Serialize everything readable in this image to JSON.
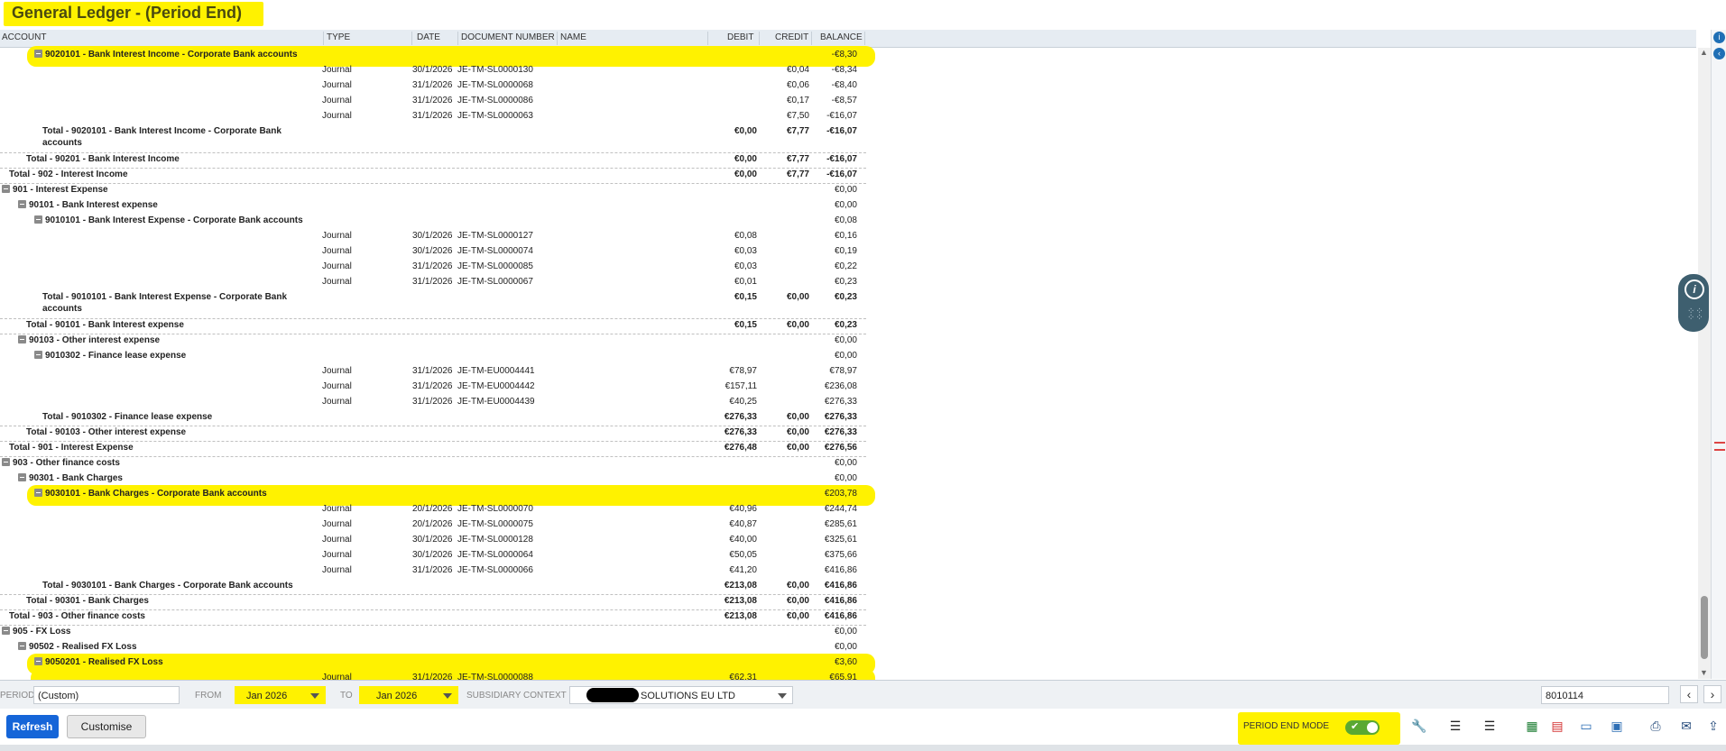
{
  "title": "General Ledger - (Period End)",
  "columns": {
    "account": "ACCOUNT",
    "type": "TYPE",
    "date": "DATE",
    "doc": "DOCUMENT NUMBER",
    "name": "NAME",
    "debit": "DEBIT",
    "credit": "CREDIT",
    "balance": "BALANCE"
  },
  "rows": [
    {
      "kind": "group",
      "indent": 2,
      "label": "9020101 - Bank Interest Income - Corporate Bank accounts",
      "balance": "-€8,30",
      "highlight": true
    },
    {
      "kind": "line",
      "type": "Journal",
      "date": "30/1/2026",
      "doc": "JE-TM-SL0000130",
      "debit": "",
      "credit": "€0,04",
      "balance": "-€8,34"
    },
    {
      "kind": "line",
      "type": "Journal",
      "date": "31/1/2026",
      "doc": "JE-TM-SL0000068",
      "debit": "",
      "credit": "€0,06",
      "balance": "-€8,40"
    },
    {
      "kind": "line",
      "type": "Journal",
      "date": "31/1/2026",
      "doc": "JE-TM-SL0000086",
      "debit": "",
      "credit": "€0,17",
      "balance": "-€8,57"
    },
    {
      "kind": "line",
      "type": "Journal",
      "date": "31/1/2026",
      "doc": "JE-TM-SL0000063",
      "debit": "",
      "credit": "€7,50",
      "balance": "-€16,07"
    },
    {
      "kind": "total",
      "indent": 2,
      "label": "Total - 9020101 - Bank Interest Income - Corporate Bank",
      "label2": "accounts",
      "debit": "€0,00",
      "credit": "€7,77",
      "balance": "-€16,07"
    },
    {
      "kind": "total",
      "indent": 1,
      "label": "Total - 90201 - Bank Interest Income",
      "debit": "€0,00",
      "credit": "€7,77",
      "balance": "-€16,07"
    },
    {
      "kind": "total",
      "indent": 0,
      "label": "Total - 902 - Interest Income",
      "debit": "€0,00",
      "credit": "€7,77",
      "balance": "-€16,07"
    },
    {
      "kind": "group",
      "indent": 0,
      "label": "901 - Interest Expense",
      "balance": "€0,00"
    },
    {
      "kind": "group",
      "indent": 1,
      "label": "90101 - Bank Interest expense",
      "balance": "€0,00"
    },
    {
      "kind": "group",
      "indent": 2,
      "label": "9010101 - Bank Interest Expense - Corporate Bank accounts",
      "balance": "€0,08"
    },
    {
      "kind": "line",
      "type": "Journal",
      "date": "30/1/2026",
      "doc": "JE-TM-SL0000127",
      "debit": "€0,08",
      "credit": "",
      "balance": "€0,16"
    },
    {
      "kind": "line",
      "type": "Journal",
      "date": "30/1/2026",
      "doc": "JE-TM-SL0000074",
      "debit": "€0,03",
      "credit": "",
      "balance": "€0,19"
    },
    {
      "kind": "line",
      "type": "Journal",
      "date": "31/1/2026",
      "doc": "JE-TM-SL0000085",
      "debit": "€0,03",
      "credit": "",
      "balance": "€0,22"
    },
    {
      "kind": "line",
      "type": "Journal",
      "date": "31/1/2026",
      "doc": "JE-TM-SL0000067",
      "debit": "€0,01",
      "credit": "",
      "balance": "€0,23"
    },
    {
      "kind": "total",
      "indent": 2,
      "label": "Total - 9010101 - Bank Interest Expense - Corporate Bank",
      "label2": "accounts",
      "debit": "€0,15",
      "credit": "€0,00",
      "balance": "€0,23"
    },
    {
      "kind": "total",
      "indent": 1,
      "label": "Total - 90101 - Bank Interest expense",
      "debit": "€0,15",
      "credit": "€0,00",
      "balance": "€0,23"
    },
    {
      "kind": "group",
      "indent": 1,
      "label": "90103 - Other interest expense",
      "balance": "€0,00"
    },
    {
      "kind": "group",
      "indent": 2,
      "label": "9010302 - Finance lease expense",
      "balance": "€0,00"
    },
    {
      "kind": "line",
      "type": "Journal",
      "date": "31/1/2026",
      "doc": "JE-TM-EU0004441",
      "debit": "€78,97",
      "credit": "",
      "balance": "€78,97"
    },
    {
      "kind": "line",
      "type": "Journal",
      "date": "31/1/2026",
      "doc": "JE-TM-EU0004442",
      "debit": "€157,11",
      "credit": "",
      "balance": "€236,08"
    },
    {
      "kind": "line",
      "type": "Journal",
      "date": "31/1/2026",
      "doc": "JE-TM-EU0004439",
      "debit": "€40,25",
      "credit": "",
      "balance": "€276,33"
    },
    {
      "kind": "total",
      "indent": 2,
      "label": "Total - 9010302 - Finance lease expense",
      "debit": "€276,33",
      "credit": "€0,00",
      "balance": "€276,33"
    },
    {
      "kind": "total",
      "indent": 1,
      "label": "Total - 90103 - Other interest expense",
      "debit": "€276,33",
      "credit": "€0,00",
      "balance": "€276,33"
    },
    {
      "kind": "total",
      "indent": 0,
      "label": "Total - 901 - Interest Expense",
      "debit": "€276,48",
      "credit": "€0,00",
      "balance": "€276,56"
    },
    {
      "kind": "group",
      "indent": 0,
      "label": "903 - Other finance costs",
      "balance": "€0,00"
    },
    {
      "kind": "group",
      "indent": 1,
      "label": "90301 - Bank Charges",
      "balance": "€0,00"
    },
    {
      "kind": "group",
      "indent": 2,
      "label": "9030101 - Bank Charges - Corporate Bank accounts",
      "balance": "€203,78",
      "highlight": true
    },
    {
      "kind": "line",
      "type": "Journal",
      "date": "20/1/2026",
      "doc": "JE-TM-SL0000070",
      "debit": "€40,96",
      "credit": "",
      "balance": "€244,74"
    },
    {
      "kind": "line",
      "type": "Journal",
      "date": "20/1/2026",
      "doc": "JE-TM-SL0000075",
      "debit": "€40,87",
      "credit": "",
      "balance": "€285,61"
    },
    {
      "kind": "line",
      "type": "Journal",
      "date": "30/1/2026",
      "doc": "JE-TM-SL0000128",
      "debit": "€40,00",
      "credit": "",
      "balance": "€325,61"
    },
    {
      "kind": "line",
      "type": "Journal",
      "date": "30/1/2026",
      "doc": "JE-TM-SL0000064",
      "debit": "€50,05",
      "credit": "",
      "balance": "€375,66"
    },
    {
      "kind": "line",
      "type": "Journal",
      "date": "31/1/2026",
      "doc": "JE-TM-SL0000066",
      "debit": "€41,20",
      "credit": "",
      "balance": "€416,86"
    },
    {
      "kind": "total",
      "indent": 2,
      "label": "Total - 9030101 - Bank Charges - Corporate Bank accounts",
      "debit": "€213,08",
      "credit": "€0,00",
      "balance": "€416,86"
    },
    {
      "kind": "total",
      "indent": 1,
      "label": "Total - 90301 - Bank Charges",
      "debit": "€213,08",
      "credit": "€0,00",
      "balance": "€416,86"
    },
    {
      "kind": "total",
      "indent": 0,
      "label": "Total - 903 - Other finance costs",
      "debit": "€213,08",
      "credit": "€0,00",
      "balance": "€416,86"
    },
    {
      "kind": "group",
      "indent": 0,
      "label": "905 - FX Loss",
      "balance": "€0,00"
    },
    {
      "kind": "group",
      "indent": 1,
      "label": "90502 - Realised FX Loss",
      "balance": "€0,00"
    },
    {
      "kind": "group",
      "indent": 2,
      "label": "9050201 - Realised FX Loss",
      "balance": "€3,60",
      "highlight": true
    },
    {
      "kind": "line",
      "type": "Journal",
      "date": "31/1/2026",
      "doc": "JE-TM-SL0000088",
      "debit": "€62,31",
      "credit": "",
      "balance": "€65,91",
      "highlight": true
    }
  ],
  "filters": {
    "period_label": "PERIOD",
    "period_value": "(Custom)",
    "from_label": "FROM",
    "from_value": "Jan 2026",
    "to_label": "TO",
    "to_value": "Jan 2026",
    "subsidiary_label": "SUBSIDIARY CONTEXT",
    "subsidiary_value": "SOLUTIONS EU LTD",
    "search_value": "8010114"
  },
  "actions": {
    "refresh": "Refresh",
    "customise": "Customise",
    "period_end_mode": "PERIOD END MODE"
  },
  "colors": {
    "highlight": "#fff200",
    "primary": "#1565d8",
    "toggle_on": "#5aa832"
  },
  "icons": [
    "wrench-icon",
    "indent-icon",
    "outdent-icon",
    "excel-icon",
    "pdf-icon",
    "doc-icon",
    "word-icon",
    "print-icon",
    "email-icon",
    "export-icon"
  ]
}
